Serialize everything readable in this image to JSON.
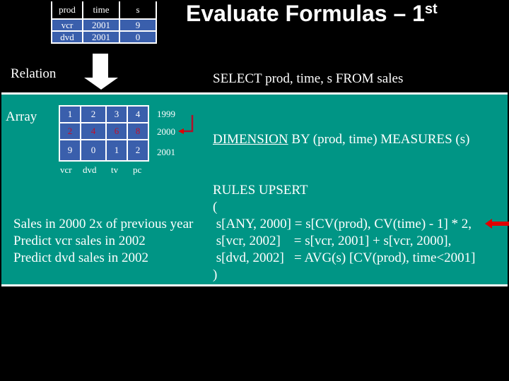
{
  "title": {
    "main": "Evaluate Formulas – 1",
    "sup": "st"
  },
  "relation_table": {
    "headers": [
      "prod",
      "time",
      "s"
    ],
    "rows": [
      [
        "vcr",
        "2001",
        "9"
      ],
      [
        "dvd",
        "2001",
        "0"
      ]
    ]
  },
  "labels": {
    "relation": "Relation",
    "array": "Array",
    "select": "SELECT prod, time, s FROM sales",
    "dimension_keyword": "DIMENSION",
    "dimension_rest": " BY (prod, time) MEASURES (s)"
  },
  "array_table": {
    "rows": [
      [
        "1",
        "2",
        "3",
        "4"
      ],
      [
        "2",
        "4",
        "6",
        "8"
      ],
      [
        "9",
        "0",
        "1",
        "2"
      ]
    ],
    "years": [
      "1999",
      "2000",
      "2001"
    ],
    "products": [
      "vcr",
      "dvd",
      "tv",
      "pc"
    ],
    "highlight_color": "#c0102a"
  },
  "rules": {
    "lines": [
      "RULES UPSERT",
      "(",
      " s[ANY, 2000] = s[CV(prod), CV(time) - 1] * 2,",
      " s[vcr, 2002]    = s[vcr, 2001] + s[vcr, 2000],",
      " s[dvd, 2002]   = AVG(s) [CV(prod), time<2001]",
      ")"
    ]
  },
  "descriptions": [
    "Sales in 2000 2x of previous year",
    "Predict vcr sales in 2002",
    "Predict dvd sales in 2002"
  ],
  "colors": {
    "panel": "#009585",
    "cell": "#3a5fac",
    "pointer": "#e00000"
  }
}
